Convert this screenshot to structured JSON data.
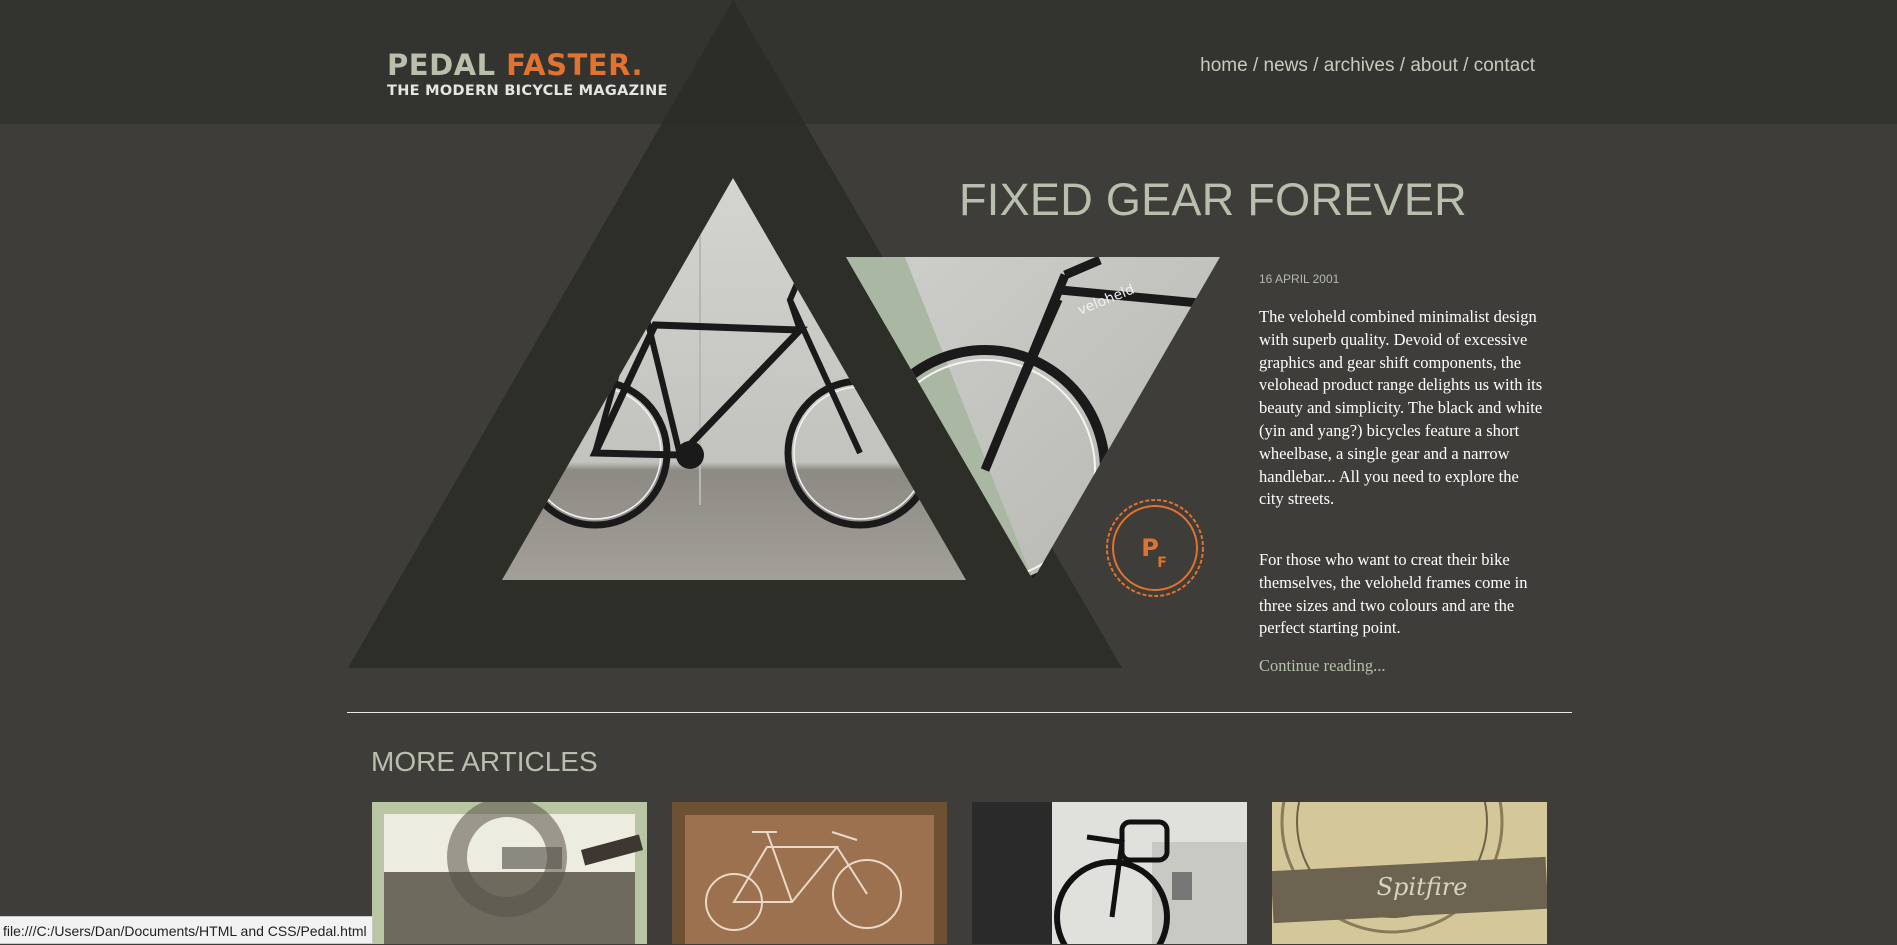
{
  "logo": {
    "word1": "PEDAL",
    "word2": "FASTER.",
    "tagline": "THE MODERN BICYCLE MAGAZINE"
  },
  "nav": {
    "items": [
      "home",
      "news",
      "archives",
      "about",
      "contact"
    ],
    "separator": " / "
  },
  "hero": {
    "badge_text": "PF"
  },
  "article": {
    "title": "FIXED GEAR FOREVER",
    "date": "16 APRIL 2001",
    "paragraphs": [
      "The veloheld combined minimalist design with superb quality. Devoid of excessive graphics and gear shift components, the velohead product range delights us with its beauty and simplicity. The black and white (yin and yang?) bicycles feature a short wheelbase, a single gear and a narrow handlebar... All you need to explore the city streets.",
      "For those who want to creat their bike themselves, the veloheld frames come in three sizes and two colours and are the perfect starting point."
    ],
    "continue": "Continue reading..."
  },
  "more": {
    "title": "MORE ARTICLES"
  },
  "status_bar": {
    "url": "file:///C:/Users/Dan/Documents/HTML and CSS/Pedal.html"
  },
  "colors": {
    "background": "#3e3d39",
    "header": "#33332f",
    "accent_orange": "#e1722f",
    "sage": "#b8c0ad"
  }
}
